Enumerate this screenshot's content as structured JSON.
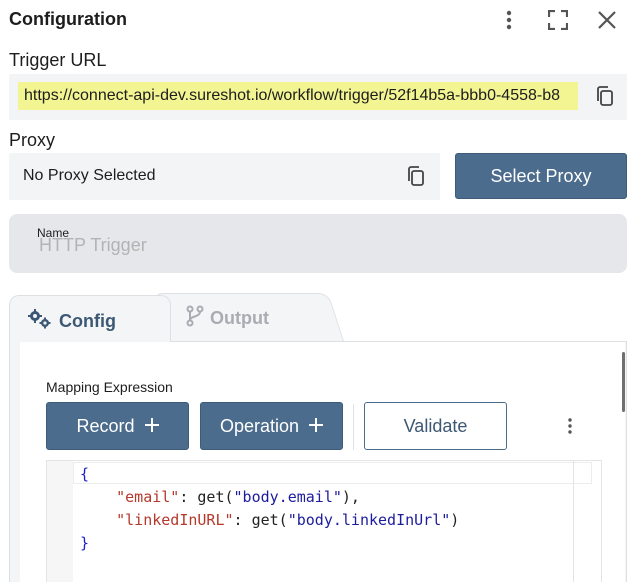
{
  "header": {
    "title": "Configuration",
    "icons": [
      "kebab-icon",
      "fullscreen-icon",
      "close-icon"
    ]
  },
  "trigger": {
    "label": "Trigger URL",
    "url": "https://connect-api-dev.sureshot.io/workflow/trigger/52f14b5a-bbb0-4558-b8"
  },
  "proxy": {
    "label": "Proxy",
    "value": "No Proxy Selected",
    "select_button": "Select Proxy"
  },
  "name_field": {
    "label": "Name",
    "placeholder": "HTTP Trigger"
  },
  "tabs": [
    {
      "label": "Config",
      "icon": "gears-icon",
      "active": true
    },
    {
      "label": "Output",
      "icon": "branch-icon",
      "active": false
    }
  ],
  "mapping": {
    "label": "Mapping Expression",
    "record_button": "Record",
    "operation_button": "Operation",
    "validate_button": "Validate"
  },
  "code": {
    "line1": "{",
    "key1": "\"email\"",
    "fn1": "get(",
    "arg1": "\"body.email\"",
    "end1": "),",
    "key2": "\"linkedInURL\"",
    "fn2": "get(",
    "arg2": "\"body.linkedInUrl\"",
    "end2": ")",
    "line4": "}"
  },
  "colors": {
    "primary": "#4b6c8c",
    "url_highlight": "#f3f592",
    "field_bg": "#f3f4f6"
  }
}
